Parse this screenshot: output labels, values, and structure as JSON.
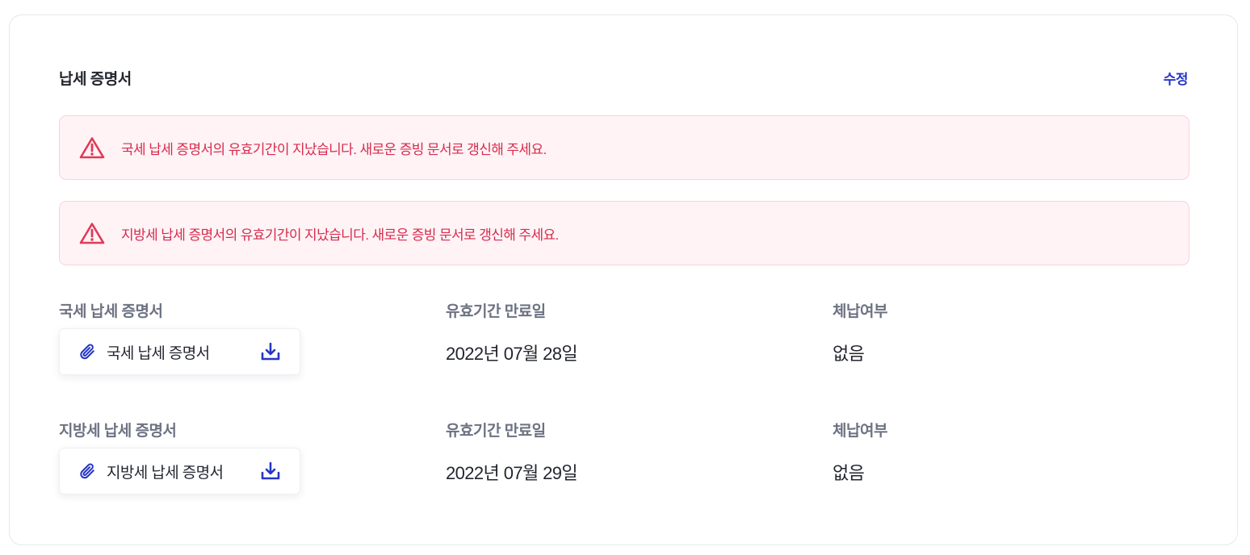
{
  "section": {
    "title": "납세 증명서",
    "edit_label": "수정"
  },
  "alerts": [
    {
      "icon": "warning-triangle-icon",
      "message": "국세 납세 증명서의 유효기간이 지났습니다. 새로운 증빙 문서로 갱신해 주세요."
    },
    {
      "icon": "warning-triangle-icon",
      "message": "지방세 납세 증명서의 유효기간이 지났습니다. 새로운 증빙 문서로 갱신해 주세요."
    }
  ],
  "certificates": [
    {
      "label": "국세 납세 증명서",
      "file_name": "국세 납세 증명서",
      "expiry_label": "유효기간 만료일",
      "expiry_value": "2022년 07월 28일",
      "arrears_label": "체납여부",
      "arrears_value": "없음"
    },
    {
      "label": "지방세 납세 증명서",
      "file_name": "지방세 납세 증명서",
      "expiry_label": "유효기간 만료일",
      "expiry_value": "2022년 07월 29일",
      "arrears_label": "체납여부",
      "arrears_value": "없음"
    }
  ],
  "colors": {
    "accent": "#2535c7",
    "alert_text": "#d62c4c",
    "alert_bg": "#fff3f6",
    "alert_border": "#f7d3dc"
  }
}
